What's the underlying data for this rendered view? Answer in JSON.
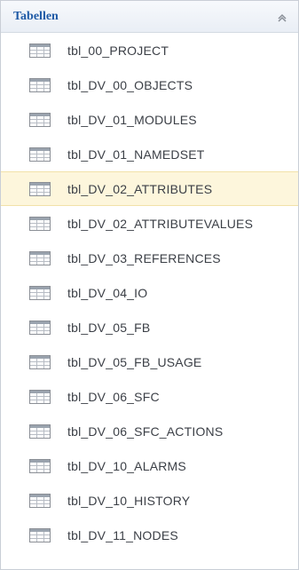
{
  "header": {
    "title": "Tabellen",
    "collapse_icon": "chevron-up-icon"
  },
  "items": [
    {
      "label": "tbl_00_PROJECT",
      "icon": "table-icon"
    },
    {
      "label": "tbl_DV_00_OBJECTS",
      "icon": "table-icon"
    },
    {
      "label": "tbl_DV_01_MODULES",
      "icon": "table-icon"
    },
    {
      "label": "tbl_DV_01_NAMEDSET",
      "icon": "table-icon"
    },
    {
      "label": "tbl_DV_02_ATTRIBUTES",
      "icon": "table-icon",
      "selected": true
    },
    {
      "label": "tbl_DV_02_ATTRIBUTEVALUES",
      "icon": "table-icon"
    },
    {
      "label": "tbl_DV_03_REFERENCES",
      "icon": "table-icon"
    },
    {
      "label": "tbl_DV_04_IO",
      "icon": "table-icon"
    },
    {
      "label": "tbl_DV_05_FB",
      "icon": "table-icon"
    },
    {
      "label": "tbl_DV_05_FB_USAGE",
      "icon": "table-icon"
    },
    {
      "label": "tbl_DV_06_SFC",
      "icon": "table-icon"
    },
    {
      "label": "tbl_DV_06_SFC_ACTIONS",
      "icon": "table-icon"
    },
    {
      "label": "tbl_DV_10_ALARMS",
      "icon": "table-icon"
    },
    {
      "label": "tbl_DV_10_HISTORY",
      "icon": "table-icon"
    },
    {
      "label": "tbl_DV_11_NODES",
      "icon": "table-icon"
    }
  ],
  "colors": {
    "header_text": "#1f5aa6",
    "selected_background": "#fdf6dc",
    "item_text": "#3b3f46"
  }
}
